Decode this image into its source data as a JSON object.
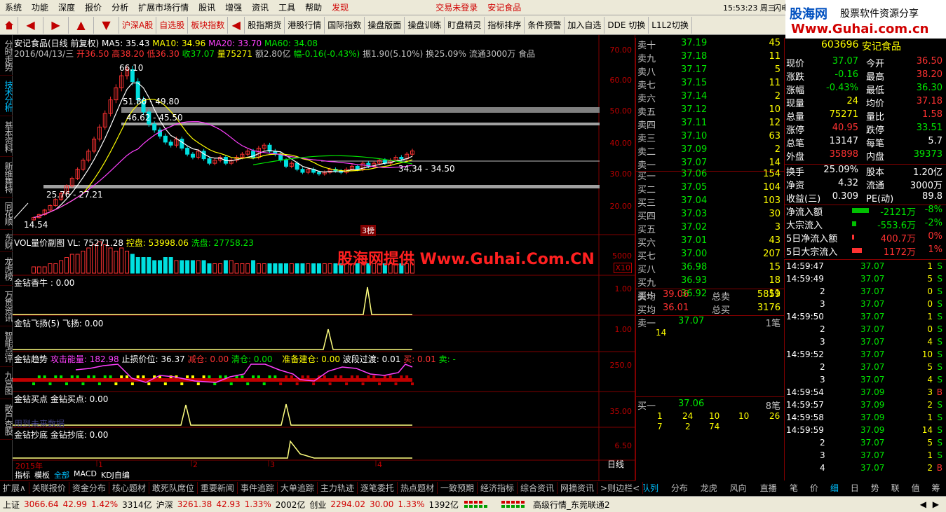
{
  "menu": {
    "items": [
      "系统",
      "功能",
      "深度",
      "报价",
      "分析",
      "扩展市场行情",
      "股讯",
      "增强",
      "资讯",
      "工具",
      "帮助"
    ],
    "alert": "发现",
    "login": "交易未登录",
    "stock": "安记食品",
    "time": "15:53:23 周三",
    "flash": "闪电"
  },
  "toolbar": {
    "buttons": [
      "沪深A股",
      "自选股",
      "板块指数",
      "股指期货",
      "港股行情",
      "国际指数",
      "操盘版面",
      "操盘训练",
      "盯盘精灵",
      "指标排序",
      "条件预警",
      "加入自选",
      "DDE 切换",
      "L1L2切换"
    ]
  },
  "logo": {
    "site": "股海网",
    "tagline": "股票软件资源分享",
    "url": "Www.Guhai.com.cn"
  },
  "sidetabs": [
    "分时走势",
    "技术分析",
    "基本资料",
    "新维舞特",
    "同花顺",
    "东财",
    "龙虎榜",
    "万贯资讯",
    "智能点评",
    "九宫图",
    "散户查股"
  ],
  "chart_header": {
    "line1": "安记食品(日线 前复权)",
    "ma5": "MA5: 35.43",
    "ma10": "MA10: 34.96",
    "ma20": "MA20: 33.70",
    "ma60": "MA60: 34.08",
    "line2_date": "2016/04/13/三",
    "open": "开36.50",
    "high": "高38.20",
    "low": "低36.30",
    "close": "收37.07",
    "vol": "量75271",
    "amt": "额2.80亿",
    "chg": "幅-0.16(-0.43%)",
    "amp": "振1.90(5.10%)",
    "turn": "换25.09%",
    "float": "流通3000万",
    "ind": "食品"
  },
  "price_annotations": {
    "high": "66.10",
    "r1": "51.80 - 49.80",
    "r2": "46.62 - 45.50",
    "r3": "34.34 - 34.50",
    "r4": "25.76 - 27.21",
    "low": "14.54",
    "badge": "3榜"
  },
  "price_axis": [
    "70.00",
    "60.00",
    "50.00",
    "40.00",
    "30.00",
    "20.00"
  ],
  "vol_panel": {
    "title": "VOL量价副图",
    "vl": "VL: 75271.28",
    "kp": "控盘: 53998.06",
    "xp": "洗盘: 27758.23",
    "axis": "5000",
    "mult": "X10"
  },
  "watermark": "股海网提供 Www.Guhai.Com.CN",
  "panels": [
    {
      "label": "金钻香牛 : 0.00",
      "axis": "1.00"
    },
    {
      "label": "金钻飞扬(5) 飞扬: 0.00",
      "axis": "1.00"
    },
    {
      "label": "金钻趋势",
      "p1": "攻击能量: 182.98",
      "p2": "止损价位: 36.37",
      "p3": "减仓: 0.00",
      "p4": "清仓: 0.00",
      "p5": "准备建仓: 0.00",
      "p6": "波段过渡: 0.01",
      "p7": "买: 0.01",
      "p8": "卖: -",
      "axis": "250.0"
    },
    {
      "label": "金钻买点 金钻买点: 0.00",
      "note": "用到未来数据",
      "axis": "35.00"
    },
    {
      "label": "金钻抄底 金钻抄底: 0.00",
      "axis": "6.50"
    }
  ],
  "time_axis": [
    "2015年",
    "1",
    "2",
    "3",
    "4"
  ],
  "period": "日线",
  "chart_tabs": [
    "指标",
    "模板",
    "全部",
    "MACD",
    "KDJ自编"
  ],
  "orderbook": {
    "sells": [
      [
        "卖十",
        "37.19",
        "45"
      ],
      [
        "卖九",
        "37.18",
        "11"
      ],
      [
        "卖八",
        "37.17",
        "5"
      ],
      [
        "卖七",
        "37.15",
        "11"
      ],
      [
        "卖六",
        "37.14",
        "2"
      ],
      [
        "卖五",
        "37.12",
        "10"
      ],
      [
        "卖四",
        "37.11",
        "12"
      ],
      [
        "卖三",
        "37.10",
        "63"
      ],
      [
        "卖二",
        "37.09",
        "2"
      ],
      [
        "卖一",
        "37.07",
        "14"
      ]
    ],
    "buys": [
      [
        "买一",
        "37.06",
        "154"
      ],
      [
        "买二",
        "37.05",
        "104"
      ],
      [
        "买三",
        "37.04",
        "103"
      ],
      [
        "买四",
        "37.03",
        "30"
      ],
      [
        "买五",
        "37.02",
        "3"
      ],
      [
        "买六",
        "37.01",
        "43"
      ],
      [
        "买七",
        "37.00",
        "207"
      ],
      [
        "买八",
        "36.98",
        "15"
      ],
      [
        "买九",
        "36.93",
        "18"
      ],
      [
        "买十",
        "36.92",
        "11"
      ]
    ],
    "avg": [
      [
        "卖均",
        "39.06",
        "总卖",
        "5859"
      ],
      [
        "买均",
        "36.01",
        "总买",
        "3176"
      ]
    ],
    "s1": {
      "label": "卖一",
      "price": "37.07",
      "count": "1笔",
      "q": [
        "14"
      ]
    },
    "b1": {
      "label": "买一",
      "price": "37.06",
      "count": "8笔",
      "q1": [
        "1",
        "24",
        "10",
        "10",
        "26"
      ],
      "q2": [
        "7",
        "2",
        "74"
      ]
    }
  },
  "quote": {
    "code": "603696",
    "name": "安记食品",
    "rows": [
      [
        "现价",
        "37.07",
        "今开",
        "36.50"
      ],
      [
        "涨跌",
        "-0.16",
        "最高",
        "38.20"
      ],
      [
        "涨幅",
        "-0.43%",
        "最低",
        "36.30"
      ],
      [
        "现量",
        "24",
        "均价",
        "37.18"
      ],
      [
        "总量",
        "75271",
        "量比",
        "1.58"
      ],
      [
        "涨停",
        "40.95",
        "跌停",
        "33.51"
      ],
      [
        "总笔",
        "13147",
        "每笔",
        "5.7"
      ],
      [
        "外盘",
        "35898",
        "内盘",
        "39373"
      ]
    ],
    "rows2": [
      [
        "换手",
        "25.09%",
        "股本",
        "1.20亿"
      ],
      [
        "净资",
        "4.32",
        "流通",
        "3000万"
      ],
      [
        "收益(三)",
        "0.309",
        "PE(动)",
        "89.8"
      ]
    ],
    "flows": [
      [
        "净流入额",
        "-2121万",
        "-8%"
      ],
      [
        "大宗流入",
        "-553.6万",
        "-2%"
      ],
      [
        "5日净流入额",
        "400.7万",
        "0%"
      ],
      [
        "5日大宗流入",
        "1172万",
        "1%"
      ]
    ]
  },
  "ticks": [
    [
      "14:59:47",
      "37.07",
      "1",
      "S"
    ],
    [
      "14:59:49",
      "37.07",
      "5",
      "S"
    ],
    [
      "2",
      "37.07",
      "0",
      "S"
    ],
    [
      "3",
      "37.07",
      "0",
      "S"
    ],
    [
      "14:59:50",
      "37.07",
      "1",
      "S"
    ],
    [
      "2",
      "37.07",
      "0",
      "S"
    ],
    [
      "3",
      "37.07",
      "4",
      "S"
    ],
    [
      "14:59:52",
      "37.07",
      "10",
      "S"
    ],
    [
      "2",
      "37.07",
      "5",
      "S"
    ],
    [
      "3",
      "37.07",
      "4",
      "S"
    ],
    [
      "14:59:54",
      "37.09",
      "3",
      "B"
    ],
    [
      "14:59:57",
      "37.09",
      "2",
      "S"
    ],
    [
      "14:59:58",
      "37.09",
      "1",
      "S"
    ],
    [
      "14:59:59",
      "37.09",
      "14",
      "S"
    ],
    [
      "2",
      "37.07",
      "5",
      "S"
    ],
    [
      "3",
      "37.07",
      "1",
      "S"
    ],
    [
      "4",
      "37.07",
      "2",
      "B"
    ]
  ],
  "ob_tabs": [
    "队列",
    "分布",
    "龙虎",
    "风向",
    "直播"
  ],
  "tick_tabs": [
    "笔",
    "价",
    "细",
    "日",
    "势",
    "联",
    "值",
    "筹"
  ],
  "bottom_tabs": [
    "扩展∧",
    "关联报价",
    "资金分布",
    "核心题材",
    "敢死队席位",
    "重要新闻",
    "事件追踪",
    "大单追踪",
    "主力轨迹",
    "逐笔委托",
    "热点题材",
    "一致预期",
    "经济指标",
    "综合资讯",
    "网摘资讯",
    ">则边栏<"
  ],
  "status": {
    "sh_label": "上证",
    "sh": "3066.64",
    "sh_chg": "42.99",
    "sh_pct": "1.42%",
    "sh_amt": "3314亿",
    "sz_label": "沪深",
    "sz": "3261.38",
    "sz_chg": "42.93",
    "sz_pct": "1.33%",
    "sz_amt": "2002亿",
    "cy_label": "创业",
    "cy": "2294.02",
    "cy_chg": "30.00",
    "cy_pct": "1.33%",
    "cy_amt": "1392亿",
    "msg": "高级行情_东莞联通2"
  },
  "chart_data": [
    {
      "type": "candlestick",
      "title": "安记食品(日线 前复权)",
      "ylim": [
        10,
        75
      ],
      "closes": [
        15,
        16,
        17.5,
        19,
        21,
        23,
        25.5,
        28,
        31,
        34,
        37,
        41,
        45,
        49.5,
        54,
        58,
        62,
        64,
        60,
        54,
        50,
        46,
        44,
        42,
        40,
        39,
        41,
        38,
        36,
        35,
        37,
        34.5,
        33,
        34,
        35,
        33,
        34,
        35,
        36,
        37,
        35,
        38,
        39,
        37,
        36,
        34,
        32,
        33,
        31,
        30,
        31,
        30,
        29.5,
        30,
        31,
        30.5,
        30,
        31,
        32,
        31,
        33,
        32,
        33,
        34,
        33,
        34,
        35,
        34.5,
        36,
        37.07
      ],
      "series": [
        {
          "name": "MA5"
        },
        {
          "name": "MA10"
        },
        {
          "name": "MA20"
        },
        {
          "name": "MA60"
        }
      ]
    }
  ]
}
